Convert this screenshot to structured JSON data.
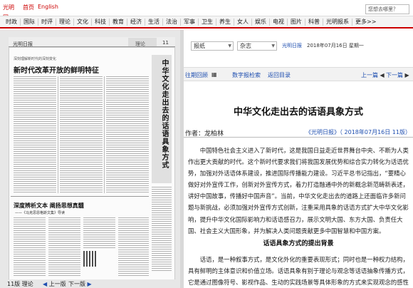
{
  "site": {
    "logo_text": "光明网",
    "home_label": "首页",
    "english_label": "English",
    "search_placeholder": "您想去哪里？"
  },
  "nav": [
    "时政",
    "国际",
    "时评",
    "理论",
    "文化",
    "科技",
    "教育",
    "经济",
    "生活",
    "法治",
    "军事",
    "卫生",
    "养生",
    "女人",
    "娱乐",
    "电视",
    "图片",
    "科普",
    "光明报系",
    "更多>>"
  ],
  "paper": {
    "brand": "光明日报",
    "section_tag": "理论",
    "page_number": "11",
    "kicker": "深刻理解新时代的深刻变化",
    "headline": "新时代改革开放的鲜明特征",
    "vertical_title": "中华文化走出去的话语具象方式",
    "headline2": "深度辨析文本 阐扬思想真髓",
    "subhead2": "——《马克思恩格斯文集》导读"
  },
  "pager": {
    "page_label": "11版 理论",
    "prev": "上一版",
    "next": "下一版"
  },
  "toolbar": {
    "select_newspaper": "报纸",
    "select_magazine": "杂志",
    "paper_name": "光明日报",
    "date": "2018年07月16日 星期一"
  },
  "issue": {
    "past": "往期回顾",
    "digital": "数字报检索",
    "return": "返回目录",
    "prev_article": "上一篇",
    "next_article": "下一篇"
  },
  "article": {
    "title": "中华文化走出去的话语具象方式",
    "author": "作者：龙柏林",
    "source": "《光明日报》（ 2018年07月16日 11版）",
    "paragraph1": "中国特色社会主义进入了新时代，这是我国日益走近世界舞台中央、不断为人类作出更大贡献的时代。这个新时代要求我们将我国发展优势和综合实力转化为话语优势，加强对外话语体系建设，推进国际传播能力建设。习近平总书记指出，“要精心做好对外宣传工作，创新对外宣传方式，着力打造融通中外的新概念新范畴新表述，讲好中国故事，传播好中国声音”。当前，中华文化走出去的道路上还面临许多新问题与新挑战，必须加强对外宣传方式创新，注重采用具象的话语方式扩大中华文化影响，提升中华文化国际影响力和话语感召力，展示文明大国、东方大国、负责任大国、社会主义大国形象，并为解决人类问题贡献更多中国智慧和中国方案。",
    "section_heading": "话语具象方式的提出背景",
    "paragraph2": "话语，是一种叙事方式，是文化外化的重要表现形式；同时也是一种权力结构，具有鲜明的主体意识和价值立场。话语具象有别于理论与观念等话语抽象传播方式，它是通过图像符号、影视作品、生动的实践场景等具体形象的方式来实现观念的感性"
  }
}
